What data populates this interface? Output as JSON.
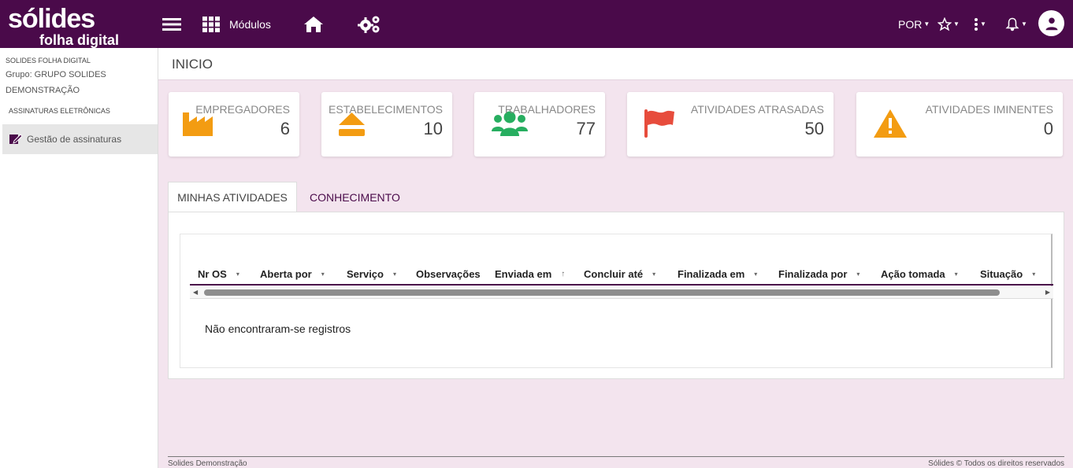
{
  "topbar": {
    "logo_line1": "sólides",
    "logo_line2": "folha digital",
    "modules_label": "Módulos",
    "language": "POR",
    "brand_color": "#4a0a4a"
  },
  "sidebar": {
    "company": "SOLIDES FOLHA DIGITAL",
    "group": "Grupo: GRUPO SOLIDES DEMONSTRAÇÃO",
    "section": "ASSINATURAS ELETRÔNICAS",
    "items": [
      {
        "label": "Gestão de assinaturas",
        "icon": "signature-icon"
      }
    ]
  },
  "page": {
    "title": "INICIO"
  },
  "cards": [
    {
      "label": "EMPREGADORES",
      "value": "6",
      "icon": "factory-icon",
      "color": "#f39c12"
    },
    {
      "label": "ESTABELECIMENTOS",
      "value": "10",
      "icon": "eject-icon",
      "color": "#f39c12"
    },
    {
      "label": "TRABALHADORES",
      "value": "77",
      "icon": "users-icon",
      "color": "#27ae60"
    },
    {
      "label": "ATIVIDADES ATRASADAS",
      "value": "50",
      "icon": "flag-icon",
      "color": "#e74c3c"
    },
    {
      "label": "ATIVIDADES IMINENTES",
      "value": "0",
      "icon": "warning-icon",
      "color": "#f39c12"
    }
  ],
  "tabs": [
    {
      "label": "MINHAS ATIVIDADES",
      "active": true
    },
    {
      "label": "CONHECIMENTO",
      "active": false
    }
  ],
  "grid": {
    "columns": [
      {
        "label": "Nr OS",
        "sort": "▾"
      },
      {
        "label": "Aberta por",
        "sort": "▾"
      },
      {
        "label": "Serviço",
        "sort": "▾"
      },
      {
        "label": "Observações",
        "sort": ""
      },
      {
        "label": "Enviada em",
        "sort": "↑"
      },
      {
        "label": "Concluir até",
        "sort": "▾"
      },
      {
        "label": "Finalizada em",
        "sort": "▾"
      },
      {
        "label": "Finalizada por",
        "sort": "▾"
      },
      {
        "label": "Ação tomada",
        "sort": "▾"
      },
      {
        "label": "Situação",
        "sort": "▾"
      }
    ],
    "empty_message": "Não encontraram-se registros"
  },
  "footer": {
    "left": "Solides Demonstração",
    "right": "Sólides © Todos os direitos reservados"
  }
}
